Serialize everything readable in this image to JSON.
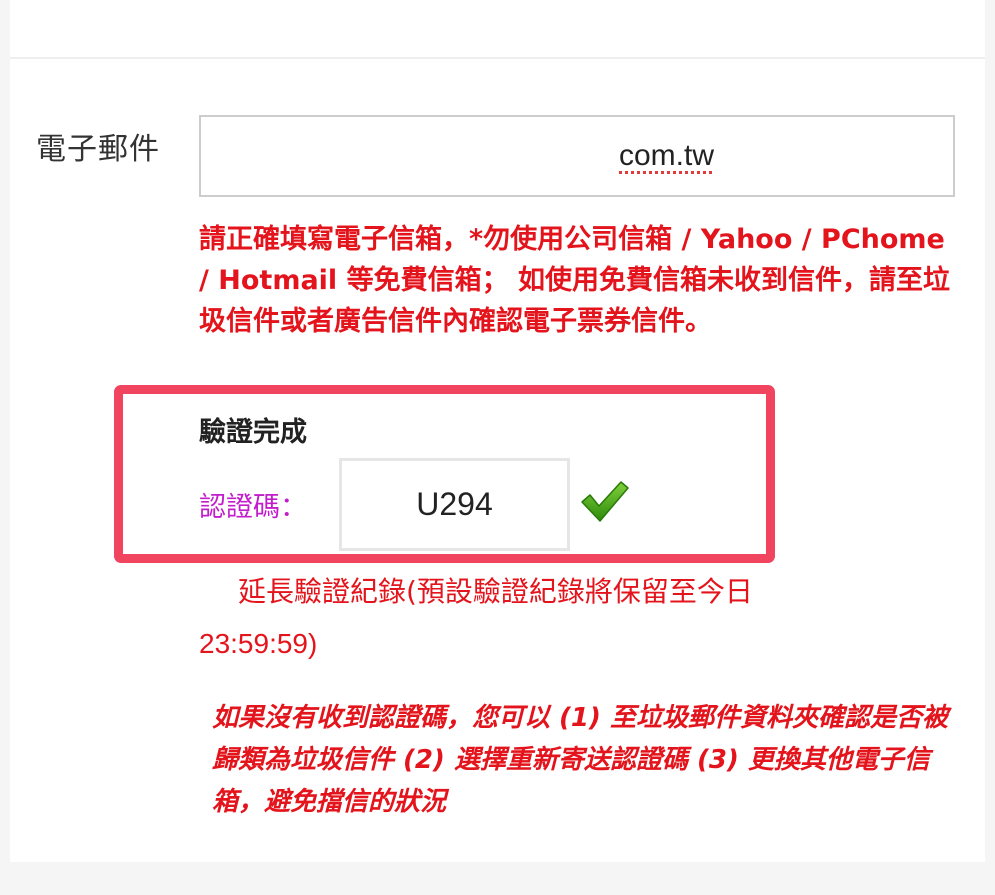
{
  "email": {
    "label": "電子郵件",
    "value": "com.tw",
    "warning": "請正確填寫電子信箱，*勿使用公司信箱 / Yahoo / PChome / Hotmail 等免費信箱； 如使用免費信箱未收到信件，請至垃圾信件或者廣告信件內確認電子票券信件。"
  },
  "verification": {
    "title": "驗證完成",
    "code_label": "認證碼：",
    "code_value": "U294",
    "status_icon": "green-check-icon",
    "extend_text_line1": "延長驗證紀錄(預設驗證紀錄將保留至今日",
    "extend_text_line2": "23:59:59)",
    "help_text": "如果沒有收到認證碼，您可以 (1) 至垃圾郵件資料夾確認是否被歸類為垃圾信件 (2) 選擇重新寄送認證碼 (3) 更換其他電子信箱，避免擋信的狀況"
  },
  "colors": {
    "warning_red": "#e4141c",
    "highlight_border": "#f0445f",
    "code_label_magenta": "#c21ccc",
    "check_green": "#3aa10f"
  }
}
